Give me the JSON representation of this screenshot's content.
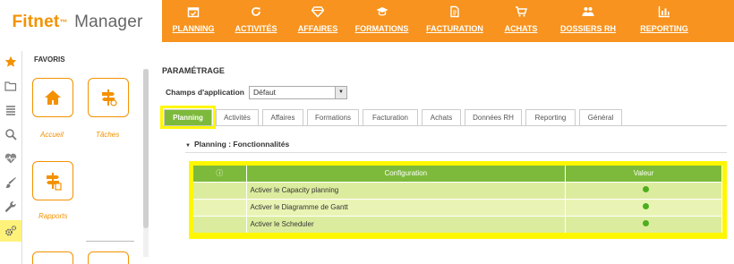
{
  "app": {
    "logo_main": "Fitnet",
    "logo_tm": "™",
    "logo_rest": "Manager"
  },
  "nav": [
    {
      "label": "PLANNING",
      "icon": "calendar-icon"
    },
    {
      "label": "ACTIVITÉS",
      "icon": "refresh-icon"
    },
    {
      "label": "AFFAIRES",
      "icon": "diamond-icon"
    },
    {
      "label": "FORMATIONS",
      "icon": "graduation-cap-icon"
    },
    {
      "label": "FACTURATION",
      "icon": "invoice-icon"
    },
    {
      "label": "ACHATS",
      "icon": "cart-icon"
    },
    {
      "label": "DOSSIERS RH",
      "icon": "users-icon"
    },
    {
      "label": "REPORTING",
      "icon": "bar-chart-icon"
    }
  ],
  "rail": [
    "star-icon",
    "folder-icon",
    "list-icon",
    "search-icon",
    "heartbeat-icon",
    "brush-icon",
    "wrench-icon",
    "gears-icon"
  ],
  "favorites": {
    "title": "FAVORIS",
    "items": [
      {
        "label": "Accueil",
        "icon": "home-icon"
      },
      {
        "label": "Tâches",
        "icon": "signpost-icon"
      },
      {
        "label": "Rapports",
        "icon": "signpost-doc-icon"
      }
    ]
  },
  "main": {
    "title": "PARAMÉTRAGE",
    "field_label": "Champs d'application",
    "field_value": "Défaut",
    "tabs": [
      "Planning",
      "Activités",
      "Affaires",
      "Formations",
      "Facturation",
      "Achats",
      "Données RH",
      "Reporting",
      "Général"
    ],
    "active_tab": "Planning",
    "section_title": "Planning : Fonctionnalités",
    "table": {
      "headers": [
        "ⓘ",
        "Configuration",
        "Valeur"
      ],
      "rows": [
        {
          "config": "Activer le Capacity planning",
          "value": "on"
        },
        {
          "config": "Activer le Diagramme de Gantt",
          "value": "on"
        },
        {
          "config": "Activer le Scheduler",
          "value": "on"
        }
      ]
    }
  },
  "colors": {
    "orange": "#f7931e",
    "green": "#7dba3b",
    "highlight": "#fff700",
    "dot": "#4caf1e"
  }
}
